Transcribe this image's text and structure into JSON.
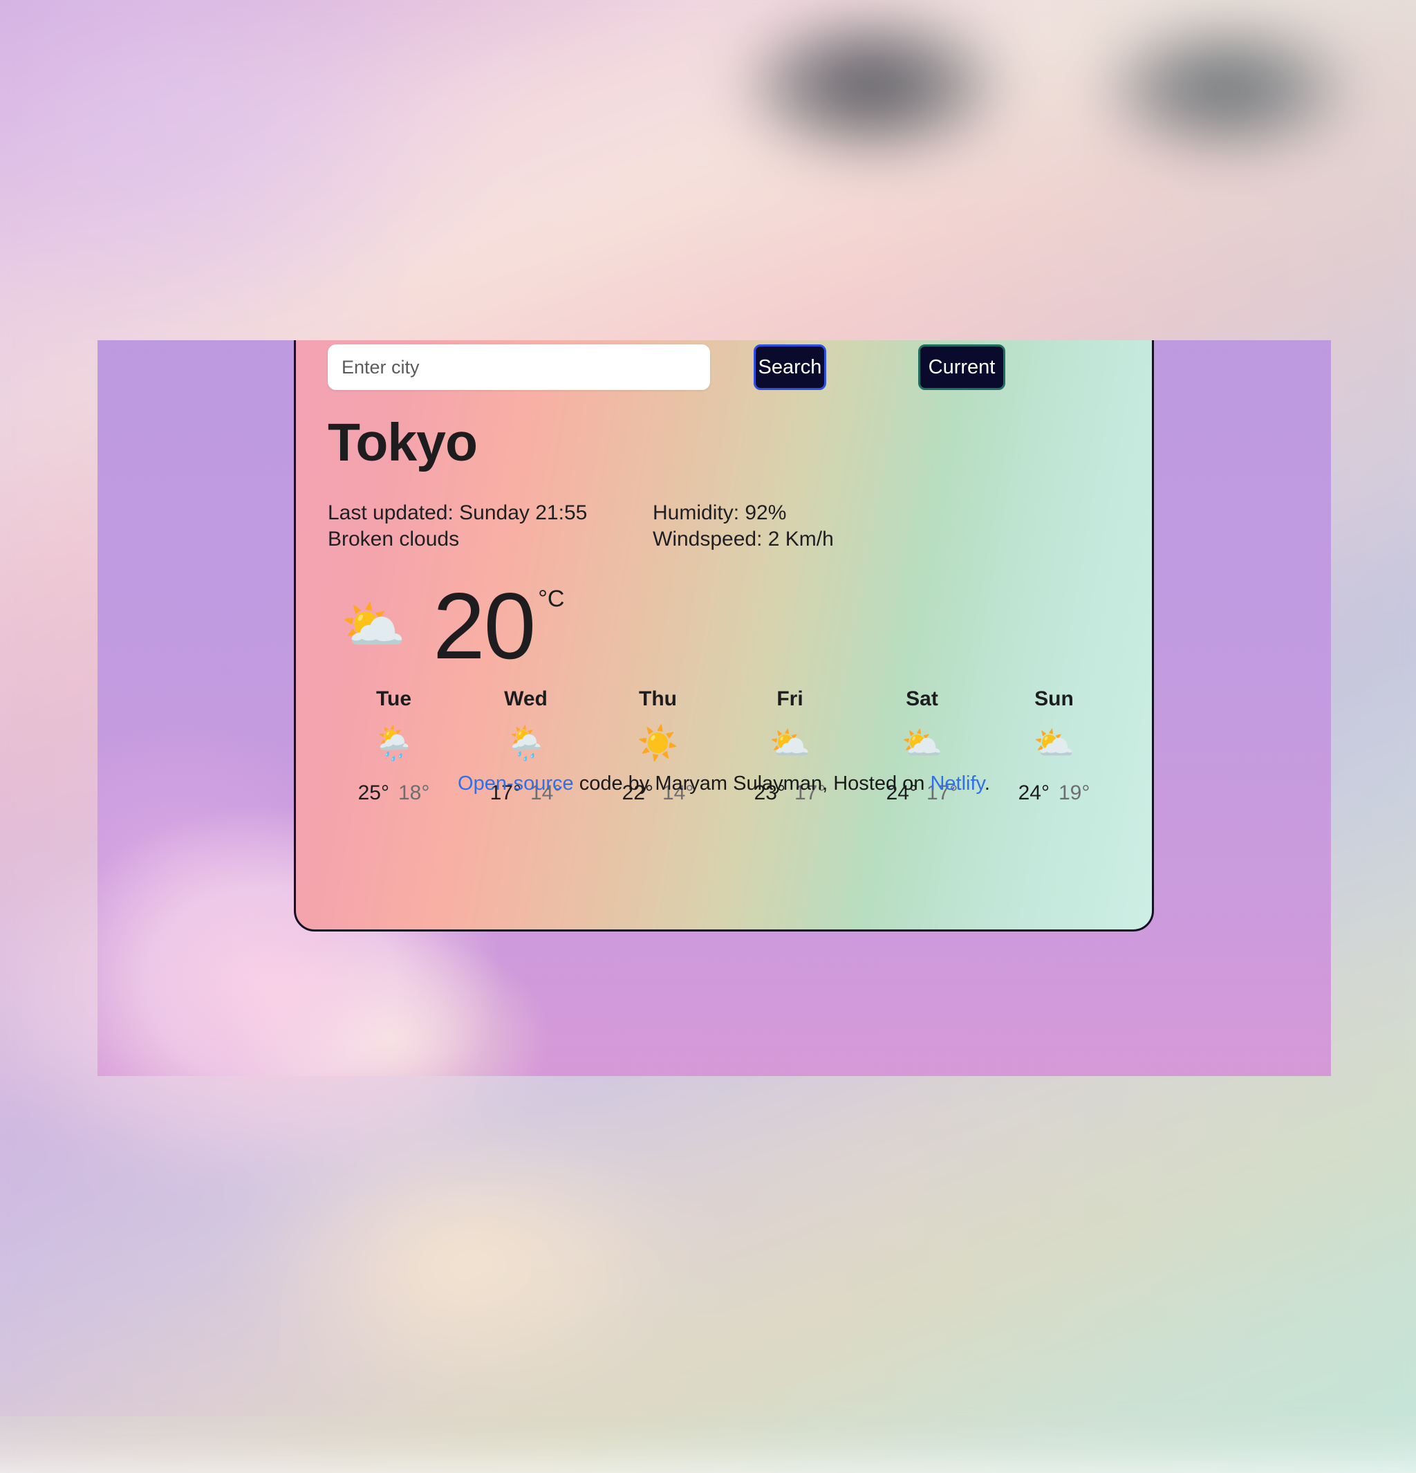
{
  "search": {
    "placeholder": "Enter city",
    "value": "",
    "search_label": "Search",
    "current_label": "Current"
  },
  "current": {
    "city": "Tokyo",
    "last_updated": "Last updated: Sunday 21:55",
    "condition": "Broken clouds",
    "humidity": "Humidity: 92%",
    "windspeed": "Windspeed: 2 Km/h",
    "temperature": "20",
    "unit": "°C",
    "icon": "⛅",
    "icon_name": "broken-clouds-icon"
  },
  "forecast": [
    {
      "day": "Tue",
      "icon": "🌦️",
      "icon_name": "sun-behind-rain-cloud-icon",
      "high": "25°",
      "low": "18°"
    },
    {
      "day": "Wed",
      "icon": "🌦️",
      "icon_name": "sun-behind-rain-cloud-icon",
      "high": "17°",
      "low": "14°"
    },
    {
      "day": "Thu",
      "icon": "☀️",
      "icon_name": "sun-icon",
      "high": "22°",
      "low": "14°"
    },
    {
      "day": "Fri",
      "icon": "⛅",
      "icon_name": "cloud-icon",
      "high": "23°",
      "low": "17°"
    },
    {
      "day": "Sat",
      "icon": "⛅",
      "icon_name": "cloud-icon",
      "high": "24°",
      "low": "17°"
    },
    {
      "day": "Sun",
      "icon": "⛅",
      "icon_name": "cloud-icon",
      "high": "24°",
      "low": "19°"
    }
  ],
  "footer": {
    "link_open_source": "Open-source",
    "middle_text": " code by Maryam Sulayman, Hosted on ",
    "link_netlify": "Netlify",
    "trailing": "."
  },
  "colors": {
    "button_bg": "#090a2c",
    "search_border": "#2f4fe0",
    "current_border": "#1d6e63",
    "link": "#2f6fe8",
    "panel_bg": "#c39ce3",
    "card_gradient_start": "#f3a3b4",
    "card_gradient_end": "#cdeee4",
    "text_primary": "#1d1d20",
    "text_muted": "#6e6e72"
  }
}
